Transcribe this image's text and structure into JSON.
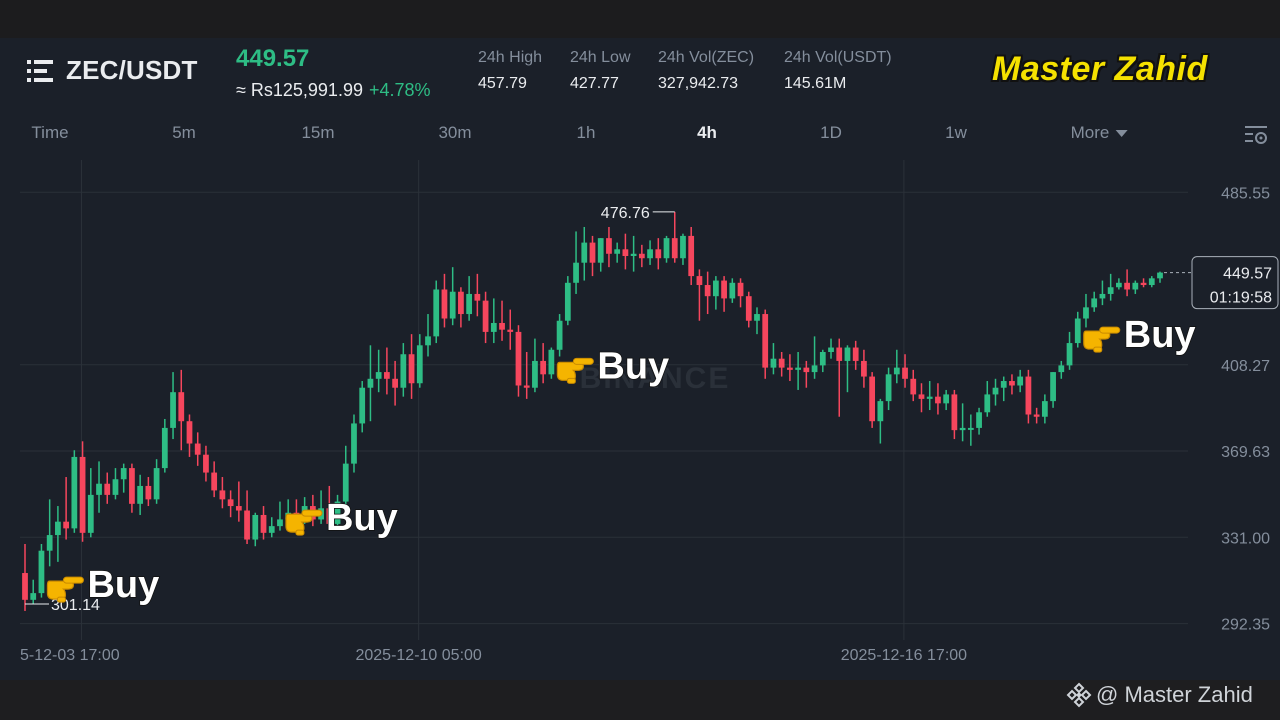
{
  "header": {
    "pair": "ZEC/USDT",
    "last_price": "449.57",
    "fiat_value": "≈ Rs125,991.99",
    "change_pct": "+4.78%",
    "stats": [
      {
        "label": "24h High",
        "value": "457.79"
      },
      {
        "label": "24h Low",
        "value": "427.77"
      },
      {
        "label": "24h Vol(ZEC)",
        "value": "327,942.73"
      },
      {
        "label": "24h Vol(USDT)",
        "value": "145.61M"
      }
    ],
    "brand": "Master Zahid"
  },
  "timeframes": [
    {
      "label": "Time",
      "active": false
    },
    {
      "label": "5m",
      "active": false
    },
    {
      "label": "15m",
      "active": false
    },
    {
      "label": "30m",
      "active": false
    },
    {
      "label": "1h",
      "active": false
    },
    {
      "label": "4h",
      "active": true
    },
    {
      "label": "1D",
      "active": false
    },
    {
      "label": "1w",
      "active": false
    },
    {
      "label": "More",
      "active": false
    }
  ],
  "footer": {
    "credit": "@ Master Zahid"
  },
  "colors": {
    "up": "#2ebd85",
    "down": "#f6465d",
    "background": "#1b2029",
    "grid": "#2b3139",
    "text_muted": "#848e9c"
  },
  "chart_data": {
    "type": "candlestick",
    "symbol": "ZEC/USDT",
    "interval": "4h",
    "ylim": [
      285,
      500
    ],
    "y_ticks": [
      292.35,
      331.0,
      369.63,
      408.27,
      485.55
    ],
    "x_tick_labels": [
      "5-12-03 17:00",
      "2025-12-10 05:00",
      "2025-12-16 17:00"
    ],
    "current_price": {
      "value": 449.57,
      "countdown": "01:19:58"
    },
    "max_marker": {
      "value": 476.76
    },
    "min_marker": {
      "value": 301.14
    },
    "watermark": "BINANCE",
    "grid": true,
    "annotations": [
      {
        "text": "Buy",
        "icon": "pointing-hand-icon",
        "near_candle": 2
      },
      {
        "text": "Buy",
        "icon": "pointing-hand-icon",
        "near_candle": 31
      },
      {
        "text": "Buy",
        "icon": "pointing-hand-icon",
        "near_candle": 64
      },
      {
        "text": "Buy",
        "icon": "pointing-hand-icon",
        "near_candle": 128
      }
    ],
    "candles": [
      {
        "o": 315,
        "h": 328,
        "c": 303,
        "l": 298
      },
      {
        "o": 303,
        "h": 312,
        "c": 306,
        "l": 301.14
      },
      {
        "o": 306,
        "h": 328,
        "c": 325,
        "l": 304
      },
      {
        "o": 325,
        "h": 348,
        "c": 332,
        "l": 318
      },
      {
        "o": 332,
        "h": 345,
        "c": 338,
        "l": 320
      },
      {
        "o": 338,
        "h": 358,
        "c": 335,
        "l": 330
      },
      {
        "o": 335,
        "h": 370,
        "c": 367,
        "l": 333
      },
      {
        "o": 367,
        "h": 374,
        "c": 333,
        "l": 329
      },
      {
        "o": 333,
        "h": 362,
        "c": 350,
        "l": 331
      },
      {
        "o": 350,
        "h": 365,
        "c": 355,
        "l": 342
      },
      {
        "o": 355,
        "h": 360,
        "c": 350,
        "l": 346
      },
      {
        "o": 350,
        "h": 362,
        "c": 357,
        "l": 348
      },
      {
        "o": 357,
        "h": 364,
        "c": 362,
        "l": 351
      },
      {
        "o": 362,
        "h": 364,
        "c": 346,
        "l": 342
      },
      {
        "o": 346,
        "h": 359,
        "c": 354,
        "l": 341
      },
      {
        "o": 354,
        "h": 358,
        "c": 348,
        "l": 345
      },
      {
        "o": 348,
        "h": 366,
        "c": 362,
        "l": 346
      },
      {
        "o": 362,
        "h": 384,
        "c": 380,
        "l": 360
      },
      {
        "o": 380,
        "h": 405,
        "c": 396,
        "l": 375
      },
      {
        "o": 396,
        "h": 406,
        "c": 383,
        "l": 370
      },
      {
        "o": 383,
        "h": 386,
        "c": 373,
        "l": 367
      },
      {
        "o": 373,
        "h": 378,
        "c": 368,
        "l": 363
      },
      {
        "o": 368,
        "h": 372,
        "c": 360,
        "l": 356
      },
      {
        "o": 360,
        "h": 365,
        "c": 352,
        "l": 349
      },
      {
        "o": 352,
        "h": 358,
        "c": 348,
        "l": 344
      },
      {
        "o": 348,
        "h": 352,
        "c": 345,
        "l": 340
      },
      {
        "o": 345,
        "h": 356,
        "c": 343,
        "l": 338
      },
      {
        "o": 343,
        "h": 352,
        "c": 330,
        "l": 328
      },
      {
        "o": 330,
        "h": 342,
        "c": 341,
        "l": 327
      },
      {
        "o": 341,
        "h": 345,
        "c": 333,
        "l": 330
      },
      {
        "o": 333,
        "h": 340,
        "c": 336,
        "l": 331
      },
      {
        "o": 336,
        "h": 347,
        "c": 339,
        "l": 334
      },
      {
        "o": 339,
        "h": 348,
        "c": 342,
        "l": 336
      },
      {
        "o": 342,
        "h": 348,
        "c": 340,
        "l": 337
      },
      {
        "o": 340,
        "h": 349,
        "c": 345,
        "l": 337
      },
      {
        "o": 345,
        "h": 350,
        "c": 339,
        "l": 336
      },
      {
        "o": 339,
        "h": 352,
        "c": 344,
        "l": 337
      },
      {
        "o": 344,
        "h": 354,
        "c": 337,
        "l": 335
      },
      {
        "o": 337,
        "h": 350,
        "c": 347,
        "l": 335
      },
      {
        "o": 347,
        "h": 372,
        "c": 364,
        "l": 343
      },
      {
        "o": 364,
        "h": 386,
        "c": 382,
        "l": 360
      },
      {
        "o": 382,
        "h": 401,
        "c": 398,
        "l": 378
      },
      {
        "o": 398,
        "h": 417,
        "c": 402,
        "l": 383
      },
      {
        "o": 402,
        "h": 415,
        "c": 405,
        "l": 396
      },
      {
        "o": 405,
        "h": 416,
        "c": 402,
        "l": 395
      },
      {
        "o": 402,
        "h": 410,
        "c": 398,
        "l": 390
      },
      {
        "o": 398,
        "h": 418,
        "c": 413,
        "l": 394
      },
      {
        "o": 413,
        "h": 422,
        "c": 400,
        "l": 393
      },
      {
        "o": 400,
        "h": 422,
        "c": 417,
        "l": 398
      },
      {
        "o": 417,
        "h": 431,
        "c": 421,
        "l": 412
      },
      {
        "o": 421,
        "h": 446,
        "c": 442,
        "l": 418
      },
      {
        "o": 442,
        "h": 449,
        "c": 429,
        "l": 425
      },
      {
        "o": 429,
        "h": 452,
        "c": 441,
        "l": 426
      },
      {
        "o": 441,
        "h": 443,
        "c": 431,
        "l": 425
      },
      {
        "o": 431,
        "h": 448,
        "c": 440,
        "l": 428
      },
      {
        "o": 440,
        "h": 449,
        "c": 437,
        "l": 430
      },
      {
        "o": 437,
        "h": 441,
        "c": 423,
        "l": 418
      },
      {
        "o": 423,
        "h": 438,
        "c": 427,
        "l": 418
      },
      {
        "o": 427,
        "h": 437,
        "c": 424,
        "l": 419
      },
      {
        "o": 424,
        "h": 433,
        "c": 423,
        "l": 415
      },
      {
        "o": 423,
        "h": 426,
        "c": 399,
        "l": 394
      },
      {
        "o": 399,
        "h": 414,
        "c": 398,
        "l": 393
      },
      {
        "o": 398,
        "h": 420,
        "c": 410,
        "l": 396
      },
      {
        "o": 410,
        "h": 418,
        "c": 404,
        "l": 400
      },
      {
        "o": 404,
        "h": 416,
        "c": 415,
        "l": 402
      },
      {
        "o": 415,
        "h": 431,
        "c": 428,
        "l": 412
      },
      {
        "o": 428,
        "h": 448,
        "c": 445,
        "l": 426
      },
      {
        "o": 445,
        "h": 468,
        "c": 454,
        "l": 440
      },
      {
        "o": 454,
        "h": 470,
        "c": 463,
        "l": 446
      },
      {
        "o": 463,
        "h": 466,
        "c": 454,
        "l": 448
      },
      {
        "o": 454,
        "h": 465,
        "c": 465,
        "l": 450
      },
      {
        "o": 465,
        "h": 470,
        "c": 458,
        "l": 452
      },
      {
        "o": 458,
        "h": 463,
        "c": 460,
        "l": 454
      },
      {
        "o": 460,
        "h": 467,
        "c": 457,
        "l": 451
      },
      {
        "o": 457,
        "h": 466,
        "c": 458,
        "l": 450
      },
      {
        "o": 458,
        "h": 462,
        "c": 456,
        "l": 452
      },
      {
        "o": 456,
        "h": 464,
        "c": 460,
        "l": 453
      },
      {
        "o": 460,
        "h": 465,
        "c": 456,
        "l": 451
      },
      {
        "o": 456,
        "h": 466,
        "c": 465,
        "l": 454
      },
      {
        "o": 465,
        "h": 476.76,
        "c": 456,
        "l": 454
      },
      {
        "o": 456,
        "h": 467,
        "c": 466,
        "l": 453
      },
      {
        "o": 466,
        "h": 470,
        "c": 448,
        "l": 444
      },
      {
        "o": 448,
        "h": 451,
        "c": 444,
        "l": 428
      },
      {
        "o": 444,
        "h": 450,
        "c": 439,
        "l": 431
      },
      {
        "o": 439,
        "h": 448,
        "c": 446,
        "l": 433
      },
      {
        "o": 446,
        "h": 448,
        "c": 438,
        "l": 432
      },
      {
        "o": 438,
        "h": 447,
        "c": 445,
        "l": 436
      },
      {
        "o": 445,
        "h": 447,
        "c": 439,
        "l": 434
      },
      {
        "o": 439,
        "h": 441,
        "c": 428,
        "l": 425
      },
      {
        "o": 428,
        "h": 434,
        "c": 431,
        "l": 422
      },
      {
        "o": 431,
        "h": 433,
        "c": 407,
        "l": 402
      },
      {
        "o": 407,
        "h": 418,
        "c": 411,
        "l": 404
      },
      {
        "o": 411,
        "h": 414,
        "c": 407,
        "l": 403
      },
      {
        "o": 407,
        "h": 413,
        "c": 406,
        "l": 401
      },
      {
        "o": 406,
        "h": 414,
        "c": 407,
        "l": 397
      },
      {
        "o": 407,
        "h": 410,
        "c": 405,
        "l": 398
      },
      {
        "o": 405,
        "h": 421,
        "c": 408,
        "l": 402
      },
      {
        "o": 408,
        "h": 415,
        "c": 414,
        "l": 405
      },
      {
        "o": 414,
        "h": 420,
        "c": 416,
        "l": 411
      },
      {
        "o": 416,
        "h": 420,
        "c": 410,
        "l": 385
      },
      {
        "o": 410,
        "h": 417,
        "c": 416,
        "l": 396
      },
      {
        "o": 416,
        "h": 419,
        "c": 410,
        "l": 406
      },
      {
        "o": 410,
        "h": 415,
        "c": 403,
        "l": 398
      },
      {
        "o": 403,
        "h": 405,
        "c": 383,
        "l": 380
      },
      {
        "o": 383,
        "h": 393,
        "c": 392,
        "l": 373
      },
      {
        "o": 392,
        "h": 407,
        "c": 404,
        "l": 388
      },
      {
        "o": 404,
        "h": 415,
        "c": 407,
        "l": 400
      },
      {
        "o": 407,
        "h": 413,
        "c": 402,
        "l": 398
      },
      {
        "o": 402,
        "h": 406,
        "c": 395,
        "l": 392
      },
      {
        "o": 395,
        "h": 400,
        "c": 393,
        "l": 387
      },
      {
        "o": 393,
        "h": 401,
        "c": 394,
        "l": 388
      },
      {
        "o": 394,
        "h": 400,
        "c": 391,
        "l": 386
      },
      {
        "o": 391,
        "h": 397,
        "c": 395,
        "l": 388
      },
      {
        "o": 395,
        "h": 397,
        "c": 379,
        "l": 375
      },
      {
        "o": 379,
        "h": 391,
        "c": 380,
        "l": 374
      },
      {
        "o": 380,
        "h": 386,
        "c": 380,
        "l": 372
      },
      {
        "o": 380,
        "h": 389,
        "c": 387,
        "l": 377
      },
      {
        "o": 387,
        "h": 401,
        "c": 395,
        "l": 385
      },
      {
        "o": 395,
        "h": 402,
        "c": 398,
        "l": 390
      },
      {
        "o": 398,
        "h": 403,
        "c": 401,
        "l": 392
      },
      {
        "o": 401,
        "h": 404,
        "c": 399,
        "l": 395
      },
      {
        "o": 399,
        "h": 406,
        "c": 403,
        "l": 396
      },
      {
        "o": 403,
        "h": 406,
        "c": 386,
        "l": 382
      },
      {
        "o": 386,
        "h": 389,
        "c": 385,
        "l": 382
      },
      {
        "o": 385,
        "h": 395,
        "c": 392,
        "l": 382
      },
      {
        "o": 392,
        "h": 405,
        "c": 405,
        "l": 389
      },
      {
        "o": 405,
        "h": 410,
        "c": 408,
        "l": 402
      },
      {
        "o": 408,
        "h": 423,
        "c": 418,
        "l": 406
      },
      {
        "o": 418,
        "h": 432,
        "c": 429,
        "l": 416
      },
      {
        "o": 429,
        "h": 440,
        "c": 434,
        "l": 425
      },
      {
        "o": 434,
        "h": 441,
        "c": 438,
        "l": 432
      },
      {
        "o": 438,
        "h": 446,
        "c": 440,
        "l": 435
      },
      {
        "o": 440,
        "h": 449,
        "c": 443,
        "l": 437
      },
      {
        "o": 443,
        "h": 447,
        "c": 445,
        "l": 442
      },
      {
        "o": 445,
        "h": 451,
        "c": 442,
        "l": 439
      },
      {
        "o": 442,
        "h": 446,
        "c": 445,
        "l": 440
      },
      {
        "o": 445,
        "h": 447,
        "c": 444,
        "l": 443
      },
      {
        "o": 444,
        "h": 448,
        "c": 447,
        "l": 443
      },
      {
        "o": 447,
        "h": 450,
        "c": 449.57,
        "l": 445
      }
    ]
  }
}
